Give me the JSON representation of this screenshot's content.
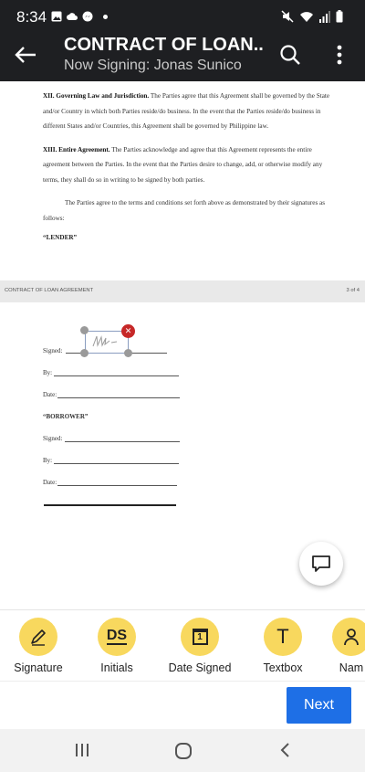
{
  "status_bar": {
    "time": "8:34"
  },
  "header": {
    "title": "CONTRACT OF LOAN...",
    "subtitle": "Now Signing: Jonas Sunico"
  },
  "document": {
    "page1": {
      "p1_heading": "XII. Governing Law and Jurisdiction.",
      "p1_text": " The Parties agree that this Agreement shall be governed by the State and/or Country in which both Parties reside/do business. In the event that the Parties reside/do business in different States and/or Countries, this Agreement shall be governed by Philippine law.",
      "p2_heading": "XIII. Entire Agreement.",
      "p2_text": " The Parties acknowledge and agree that this Agreement represents the entire agreement between the Parties. In the event that the Parties desire to change, add, or otherwise modify any terms, they shall do so in writing to be signed by both parties.",
      "p3_text": "The Parties agree to the terms and conditions set forth above as demonstrated by their signatures as follows:",
      "lender_label": "“LENDER”"
    },
    "page_break": {
      "doc_name": "CONTRACT OF LOAN AGREEMENT",
      "page_indicator": "3 of 4"
    },
    "page2": {
      "signed_label": "Signed:",
      "by_label": "By:",
      "date_label": "Date:",
      "borrower_label": "“BORROWER”",
      "signed_label_2": "Signed:",
      "by_label_2": "By:",
      "date_label_2": "Date:"
    }
  },
  "tools": [
    {
      "label": "Signature",
      "icon": "pen-icon"
    },
    {
      "label": "Initials",
      "icon": "ds-initials-icon",
      "glyph": "DS"
    },
    {
      "label": "Date Signed",
      "icon": "calendar-icon",
      "glyph": "1"
    },
    {
      "label": "Textbox",
      "icon": "text-t-icon",
      "glyph": "T"
    },
    {
      "label": "Nam",
      "icon": "person-icon"
    }
  ],
  "actions": {
    "next_label": "Next"
  },
  "colors": {
    "header_bg": "#1e1f22",
    "tool_circle": "#f8d85e",
    "next_button": "#1e6fe6",
    "delete_badge": "#c62828",
    "signature_box_border": "#8a9dc0"
  }
}
